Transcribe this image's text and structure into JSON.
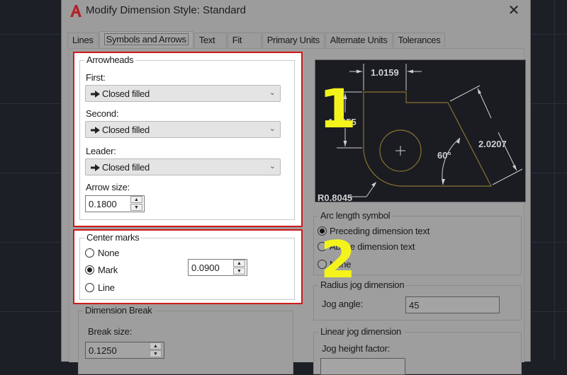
{
  "window": {
    "title": "Modify Dimension Style: Standard",
    "close_label": "✕"
  },
  "tabs": [
    {
      "label": "Lines",
      "active": false
    },
    {
      "label": "Symbols and Arrows",
      "active": true
    },
    {
      "label": "Text",
      "active": false
    },
    {
      "label": "Fit",
      "active": false
    },
    {
      "label": "Primary Units",
      "active": false
    },
    {
      "label": "Alternate Units",
      "active": false
    },
    {
      "label": "Tolerances",
      "active": false
    }
  ],
  "arrowheads": {
    "legend": "Arrowheads",
    "first_label": "First:",
    "first_value": "Closed filled",
    "second_label": "Second:",
    "second_value": "Closed filled",
    "leader_label": "Leader:",
    "leader_value": "Closed filled",
    "arrow_size_label": "Arrow size:",
    "arrow_size_value": "0.1800"
  },
  "center_marks": {
    "legend": "Center marks",
    "options": [
      {
        "label": "None",
        "checked": false
      },
      {
        "label": "Mark",
        "checked": true
      },
      {
        "label": "Line",
        "checked": false
      }
    ],
    "size_value": "0.0900"
  },
  "dimension_break": {
    "legend": "Dimension Break",
    "break_size_label": "Break size:",
    "break_size_value": "0.1250"
  },
  "preview": {
    "dim_top": "1.0159",
    "dim_left": "1.1955",
    "dim_right": "2.0207",
    "angle": "60°",
    "radius": "R0.8045",
    "colors": {
      "background": "#1a1c22",
      "geometry": "#8a7330",
      "dims": "#d0d0d0"
    }
  },
  "arc_length_symbol": {
    "legend": "Arc length symbol",
    "options": [
      {
        "label": "Preceding dimension text",
        "checked": true
      },
      {
        "label": "Above dimension text",
        "checked": false
      },
      {
        "label": "None",
        "checked": false
      }
    ]
  },
  "radius_jog": {
    "legend": "Radius jog dimension",
    "jog_angle_label": "Jog angle:",
    "jog_angle_value": "45"
  },
  "linear_jog": {
    "legend": "Linear jog dimension",
    "jog_height_label": "Jog height factor:"
  },
  "annotations": {
    "callout_1": "1",
    "callout_2": "2",
    "highlight_color": "#d01818",
    "callout_color": "#f4f41c"
  }
}
